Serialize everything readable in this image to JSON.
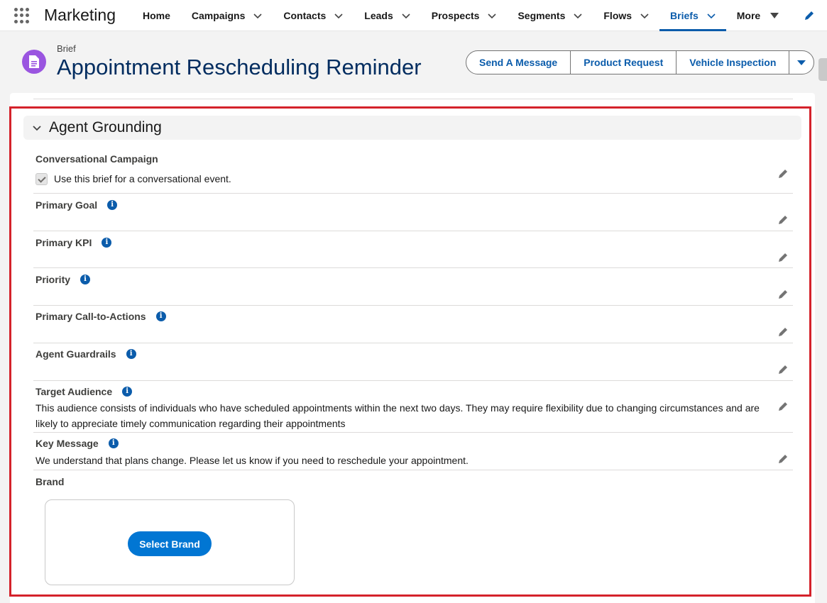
{
  "app": {
    "name": "Marketing"
  },
  "nav": {
    "items": [
      {
        "label": "Home",
        "dropdown": false
      },
      {
        "label": "Campaigns",
        "dropdown": true
      },
      {
        "label": "Contacts",
        "dropdown": true
      },
      {
        "label": "Leads",
        "dropdown": true
      },
      {
        "label": "Prospects",
        "dropdown": true
      },
      {
        "label": "Segments",
        "dropdown": true
      },
      {
        "label": "Flows",
        "dropdown": true
      },
      {
        "label": "Briefs",
        "dropdown": true,
        "active": true
      }
    ],
    "more_label": "More"
  },
  "record": {
    "object_label": "Brief",
    "title": "Appointment Rescheduling Reminder",
    "icon": "document-icon",
    "icon_color": "#9a55e0"
  },
  "actions": {
    "send_message": "Send A Message",
    "product_request": "Product Request",
    "vehicle_inspection": "Vehicle Inspection"
  },
  "section": {
    "title": "Agent Grounding",
    "fields": {
      "conversational": {
        "label": "Conversational Campaign",
        "checkbox_label": "Use this brief for a conversational event.",
        "checked": true
      },
      "primary_goal": {
        "label": "Primary Goal",
        "value": ""
      },
      "primary_kpi": {
        "label": "Primary KPI",
        "value": ""
      },
      "priority": {
        "label": "Priority",
        "value": ""
      },
      "primary_cta": {
        "label": "Primary Call-to-Actions",
        "value": ""
      },
      "guardrails": {
        "label": "Agent Guardrails",
        "value": ""
      },
      "target_audience": {
        "label": "Target Audience",
        "value": "This audience consists of individuals who have scheduled appointments within the next two days. They may require flexibility due to changing circumstances and are likely to appreciate timely communication regarding their appointments"
      },
      "key_message": {
        "label": "Key Message",
        "value": "We understand that plans change. Please let us know if you need to reschedule your appointment."
      },
      "brand": {
        "label": "Brand",
        "button": "Select Brand"
      }
    }
  },
  "colors": {
    "brand_blue": "#0b5cab",
    "button_blue": "#0176d3",
    "highlight_red": "#d4222b"
  }
}
